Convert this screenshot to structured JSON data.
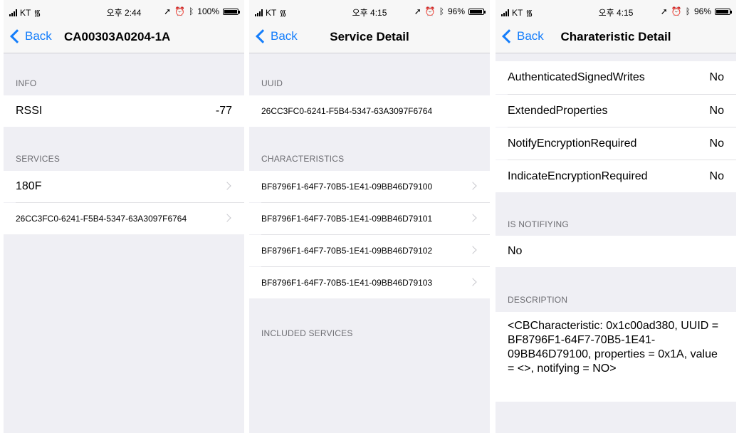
{
  "screens": [
    {
      "status": {
        "carrier": "KT",
        "time": "오후 2:44",
        "battery": "100%",
        "battery_level": 1.0
      },
      "nav": {
        "back": "Back",
        "title": "CA00303A0204-1A"
      },
      "info_header": "INFO",
      "rssi": {
        "label": "RSSI",
        "value": "-77"
      },
      "services_header": "SERVICES",
      "services": [
        "180F",
        "26CC3FC0-6241-F5B4-5347-63A3097F6764"
      ]
    },
    {
      "status": {
        "carrier": "KT",
        "time": "오후 4:15",
        "battery": "96%",
        "battery_level": 0.96
      },
      "nav": {
        "back": "Back",
        "title": "Service Detail"
      },
      "uuid_header": "UUID",
      "uuid": "26CC3FC0-6241-F5B4-5347-63A3097F6764",
      "characteristics_header": "CHARACTERISTICS",
      "characteristics": [
        "BF8796F1-64F7-70B5-1E41-09BB46D79100",
        "BF8796F1-64F7-70B5-1E41-09BB46D79101",
        "BF8796F1-64F7-70B5-1E41-09BB46D79102",
        "BF8796F1-64F7-70B5-1E41-09BB46D79103"
      ],
      "included_header": "INCLUDED SERVICES"
    },
    {
      "status": {
        "carrier": "KT",
        "time": "오후 4:15",
        "battery": "96%",
        "battery_level": 0.96
      },
      "nav": {
        "back": "Back",
        "title": "Charateristic Detail"
      },
      "properties": [
        {
          "label": "AuthenticatedSignedWrites",
          "value": "No"
        },
        {
          "label": "ExtendedProperties",
          "value": "No"
        },
        {
          "label": "NotifyEncryptionRequired",
          "value": "No"
        },
        {
          "label": "IndicateEncryptionRequired",
          "value": "No"
        }
      ],
      "notifying_header": "IS NOTIFIYING",
      "notifying_value": "No",
      "description_header": "DESCRIPTION",
      "description": "<CBCharacteristic: 0x1c00ad380, UUID = BF8796F1-64F7-70B5-1E41-09BB46D79100, properties = 0x1A, value = <>, notifying = NO>"
    }
  ]
}
